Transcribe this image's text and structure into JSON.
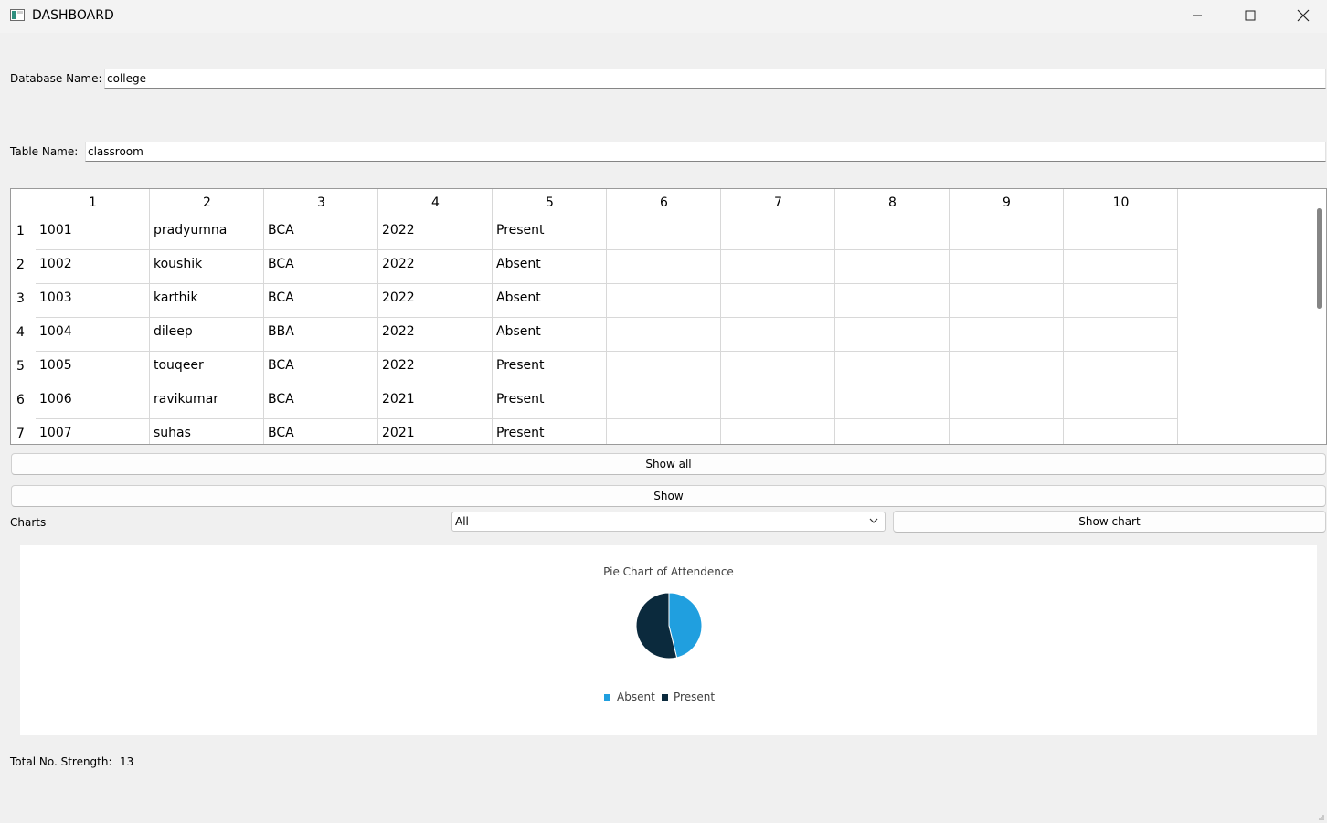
{
  "window": {
    "title": "DASHBOARD"
  },
  "database": {
    "label": "Database Name:",
    "value": "college"
  },
  "table_name": {
    "label": "Table Name:",
    "value": "classroom"
  },
  "grid": {
    "columns": [
      "1",
      "2",
      "3",
      "4",
      "5",
      "6",
      "7",
      "8",
      "9",
      "10"
    ],
    "row_numbers": [
      "1",
      "2",
      "3",
      "4",
      "5",
      "6",
      "7"
    ],
    "rows": [
      [
        "1001",
        "pradyumna",
        "BCA",
        "2022",
        "Present"
      ],
      [
        "1002",
        "koushik",
        "BCA",
        "2022",
        "Absent"
      ],
      [
        "1003",
        "karthik",
        "BCA",
        "2022",
        "Absent"
      ],
      [
        "1004",
        "dileep",
        "BBA",
        "2022",
        "Absent"
      ],
      [
        "1005",
        "touqeer",
        "BCA",
        "2022",
        "Present"
      ],
      [
        "1006",
        "ravikumar",
        "BCA",
        "2021",
        "Present"
      ],
      [
        "1007",
        "suhas",
        "BCA",
        "2021",
        "Present"
      ]
    ]
  },
  "buttons": {
    "show_all": "Show all",
    "show": "Show",
    "show_chart": "Show chart"
  },
  "charts": {
    "label": "Charts",
    "selected": "All"
  },
  "chart_data": {
    "type": "pie",
    "title": "Pie Chart of Attendence",
    "categories": [
      "Absent",
      "Present"
    ],
    "values": [
      6,
      7
    ],
    "colors": [
      "#209fdf",
      "#0b2a3d"
    ],
    "legend": "bottom-center"
  },
  "footer": {
    "label": "Total No. Strength:",
    "value": "13"
  }
}
